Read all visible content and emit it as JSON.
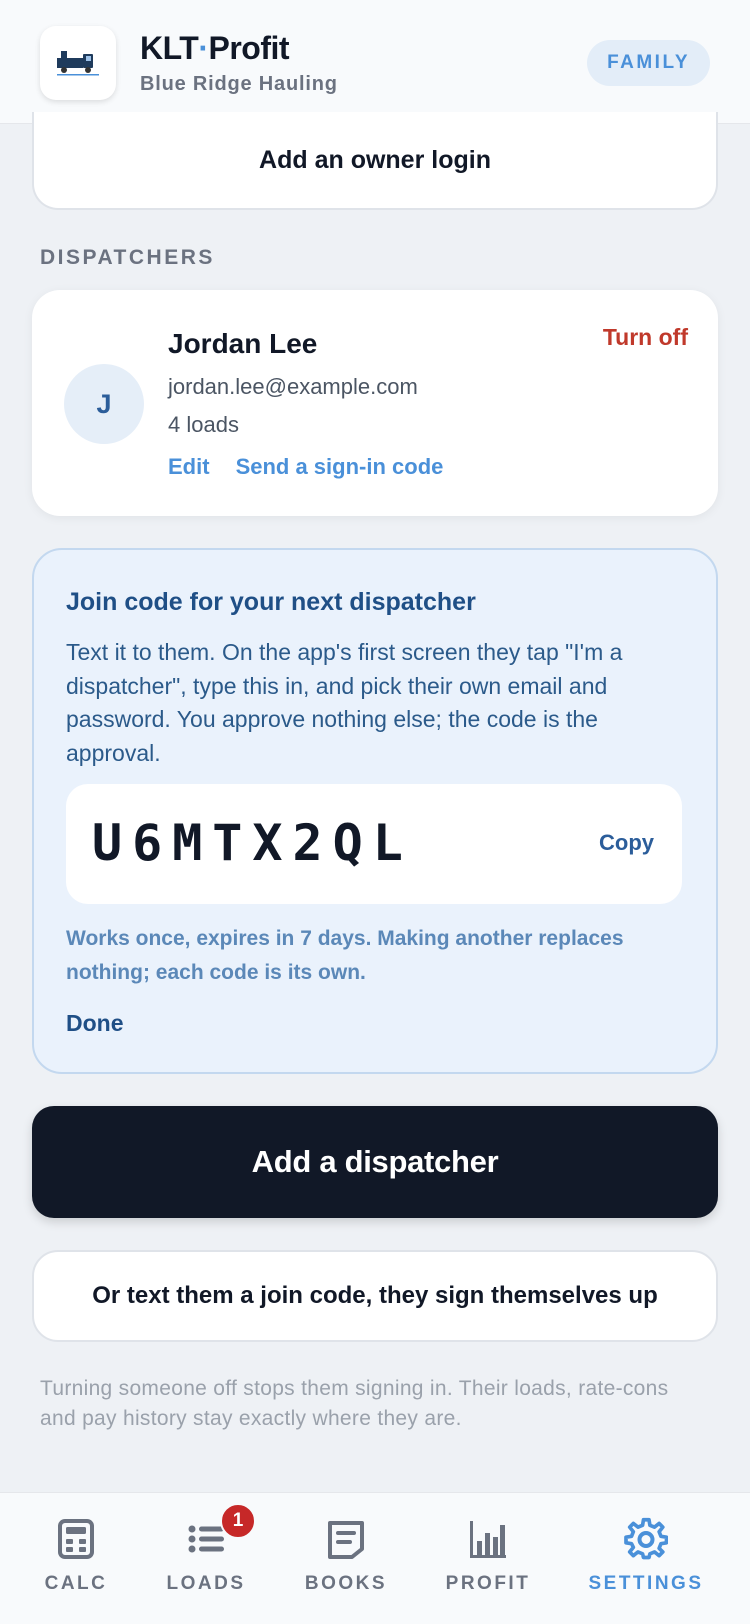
{
  "header": {
    "brand_prefix": "KLT",
    "brand_dot": "·",
    "brand_suffix": "Profit",
    "company": "Blue Ridge Hauling",
    "plan_badge": "FAMILY"
  },
  "owner": {
    "add_owner_label": "Add an owner login"
  },
  "dispatchers": {
    "section_label": "DISPATCHERS",
    "items": [
      {
        "initial": "J",
        "name": "Jordan Lee",
        "email": "jordan.lee@example.com",
        "loads": "4 loads",
        "edit_label": "Edit",
        "send_code_label": "Send a sign-in code",
        "turn_off_label": "Turn off"
      }
    ]
  },
  "join_code": {
    "title": "Join code for your next dispatcher",
    "description": "Text it to them. On the app's first screen they tap \"I'm a dispatcher\", type this in, and pick their own email and password. You approve nothing else; the code is the approval.",
    "code": "U6MTX2QL",
    "copy_label": "Copy",
    "note": "Works once, expires in 7 days. Making another replaces nothing; each code is its own.",
    "done_label": "Done"
  },
  "actions": {
    "add_dispatcher_label": "Add a dispatcher",
    "join_code_label": "Or text them a join code, they sign themselves up"
  },
  "footnote": "Turning someone off stops them signing in. Their loads, rate-cons and pay history stay exactly where they are.",
  "tabs": [
    {
      "label": "CALC",
      "icon": "calculator-icon",
      "active": false
    },
    {
      "label": "LOADS",
      "icon": "list-icon",
      "active": false,
      "badge": "1"
    },
    {
      "label": "BOOKS",
      "icon": "document-icon",
      "active": false
    },
    {
      "label": "PROFIT",
      "icon": "bar-chart-icon",
      "active": false
    },
    {
      "label": "SETTINGS",
      "icon": "gear-icon",
      "active": true
    }
  ],
  "colors": {
    "accent": "#4a90d9",
    "danger": "#c0392b",
    "primary_button": "#111827",
    "join_panel_bg": "#eaf2fc"
  }
}
